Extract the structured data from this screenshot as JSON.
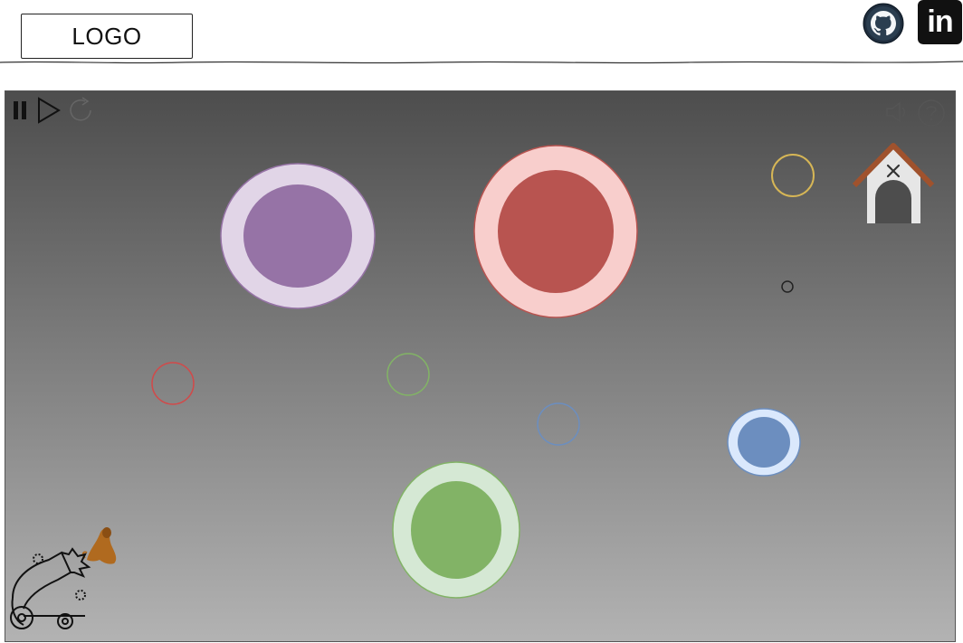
{
  "header": {
    "logo_label": "LOGO",
    "github_icon": "github-icon",
    "linkedin_label": "in"
  },
  "game": {
    "background_top": "#4d4d4d",
    "background_bottom": "#b3b3b3",
    "controls": {
      "pause_icon": "pause-icon",
      "play_icon": "play-icon",
      "restart_icon": "restart-icon",
      "sound_icon": "sound-icon",
      "help_icon": "help-icon"
    },
    "colors": {
      "purple_inner": "#9673a6",
      "purple_outer": "#e1d5e7",
      "red_inner": "#b85450",
      "red_outer": "#f8cecc",
      "green_inner": "#82b366",
      "green_outer": "#d5e8d4",
      "blue_inner": "#6c8ebf",
      "blue_outer": "#dae8fc",
      "yellow_ring": "#d6b656",
      "doghouse_roof": "#a0522d"
    }
  }
}
